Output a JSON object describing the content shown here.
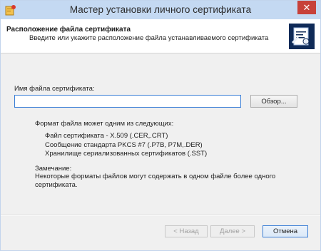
{
  "window": {
    "title": "Мастер установки личного сертификата",
    "close_label": "✕",
    "icon": "certificate-app-icon"
  },
  "header": {
    "title": "Расположение файла сертификата",
    "subtitle": "Введите или укажите расположение файла устанавливаемого сертификата",
    "icon": "certificate-document-icon"
  },
  "file": {
    "label": "Имя файла сертификата:",
    "value": "",
    "browse_label": "Обзор..."
  },
  "formats": {
    "heading": "Формат файла может одним из следующих:",
    "items": [
      "Файл сертификата - X.509 (.CER,.CRT)",
      "Сообщение стандарта PKCS #7 (.P7B, P7M,.DER)",
      "Хранилище сериализованных сертификатов (.SST)"
    ]
  },
  "note": {
    "label": "Замечание:",
    "text": "Некоторые форматы файлов могут содержать в одном файле более одного сертификата."
  },
  "footer": {
    "back_label": "< Назад",
    "next_label": "Далее >",
    "cancel_label": "Отмена"
  },
  "colors": {
    "title_bar": "#c4d9f2",
    "close_button": "#c7413a",
    "focus_border": "#3c7fd6",
    "header_icon_bg": "#0f2a57"
  }
}
